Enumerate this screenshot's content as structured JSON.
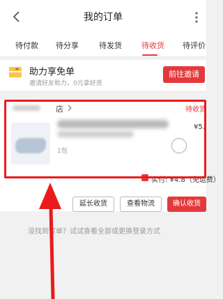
{
  "nav": {
    "title": "我的订单",
    "back_icon": "chevron-left-icon",
    "more_icon": "more-icon"
  },
  "tabs": [
    {
      "label": "待付款"
    },
    {
      "label": "待分享"
    },
    {
      "label": "待发货"
    },
    {
      "label": "待收货",
      "active": true
    },
    {
      "label": "待评价"
    }
  ],
  "promo": {
    "title": "助力享免单",
    "subtitle": "邀请好友助力，0元拿好货",
    "button": "前往邀请",
    "icon": "gift-icon"
  },
  "order": {
    "shop_name": "店",
    "status": "待收货",
    "product_name": "",
    "quantity": "1包",
    "price": "¥5.",
    "total_label": "实付: ¥4.8（免运费）",
    "actions": [
      "延长收货",
      "查看物流",
      "确认收货"
    ]
  },
  "hint": "没找到订单？试试查看全部或更换登录方式",
  "colors": {
    "accent": "#e4393c",
    "annotation": "#ea1b1b"
  }
}
